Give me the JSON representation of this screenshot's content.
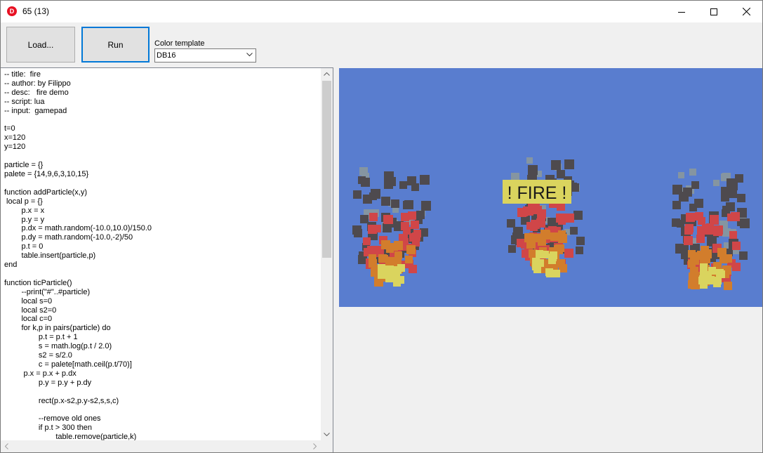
{
  "window": {
    "title": "65 (13)",
    "app_icon_letter": "D",
    "controls": [
      "minimize-icon",
      "maximize-icon",
      "close-icon"
    ]
  },
  "toolbar": {
    "load_label": "Load...",
    "run_label": "Run",
    "color_template_label": "Color template",
    "color_template_value": "DB16"
  },
  "editor": {
    "code": "-- title:  fire\n-- author: by Filippo\n-- desc:   fire demo\n-- script: lua\n-- input:  gamepad\n\nt=0\nx=120\ny=120\n\nparticle = {}\npalete = {14,9,6,3,10,15}\n\nfunction addParticle(x,y)\n local p = {}\n\tp.x = x\n\tp.y = y\n\tp.dx = math.random(-10.0,10.0)/150.0\n\tp.dy = math.random(-10.0,-2)/50\n\tp.t = 0\n\ttable.insert(particle,p)\nend\n\nfunction ticParticle()\n\t--print(\"#\"..#particle)\n\tlocal s=0\n\tlocal s2=0\n\tlocal c=0\n\tfor k,p in pairs(particle) do\n\t\tp.t = p.t + 1\n\t\ts = math.log(p.t / 2.0)\n\t\ts2 = s/2.0\n\t\tc = palete[math.ceil(p.t/70)]\n\t p.x = p.x + p.dx\n\t\tp.y = p.y + p.dy\n\n\t\trect(p.x-s2,p.y-s2,s,s,c)\n\n\t\t--remove old ones\n\t\tif p.t > 300 then\n\t\t\ttable.remove(particle,k)"
  },
  "game": {
    "banner_text": "! FIRE !",
    "colors": {
      "background": "#597dcf",
      "banner": "#dad45e",
      "dark": "#4e4a4e",
      "gray": "#8595a1",
      "red": "#d04648",
      "orange": "#d27d2c",
      "yellow": "#dad45e"
    }
  }
}
